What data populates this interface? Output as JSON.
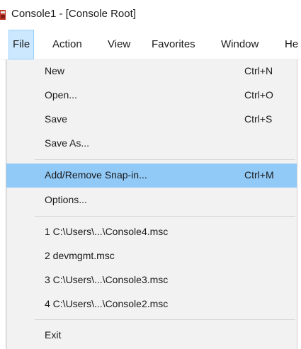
{
  "window": {
    "title": "Console1 - [Console Root]",
    "app_icon": "mmc-icon"
  },
  "menubar": {
    "items": [
      {
        "label": "File",
        "active": true
      },
      {
        "label": "Action"
      },
      {
        "label": "View"
      },
      {
        "label": "Favorites"
      },
      {
        "label": "Window"
      },
      {
        "label": "He"
      }
    ]
  },
  "file_menu": {
    "items": [
      {
        "label": "New",
        "shortcut": "Ctrl+N"
      },
      {
        "label": "Open...",
        "shortcut": "Ctrl+O"
      },
      {
        "label": "Save",
        "shortcut": "Ctrl+S"
      },
      {
        "label": "Save As...",
        "shortcut": ""
      },
      {
        "label": "Add/Remove Snap-in...",
        "shortcut": "Ctrl+M",
        "highlighted": true
      },
      {
        "label": "Options...",
        "shortcut": ""
      },
      {
        "label": "1 C:\\Users\\...\\Console4.msc",
        "shortcut": ""
      },
      {
        "label": "2 devmgmt.msc",
        "shortcut": ""
      },
      {
        "label": "3 C:\\Users\\...\\Console3.msc",
        "shortcut": ""
      },
      {
        "label": "4 C:\\Users\\...\\Console2.msc",
        "shortcut": ""
      },
      {
        "label": "Exit",
        "shortcut": ""
      }
    ]
  },
  "colors": {
    "highlight": "#91c9f7",
    "menu_background": "#f2f2f2",
    "active_menubar": "#cce8ff"
  }
}
